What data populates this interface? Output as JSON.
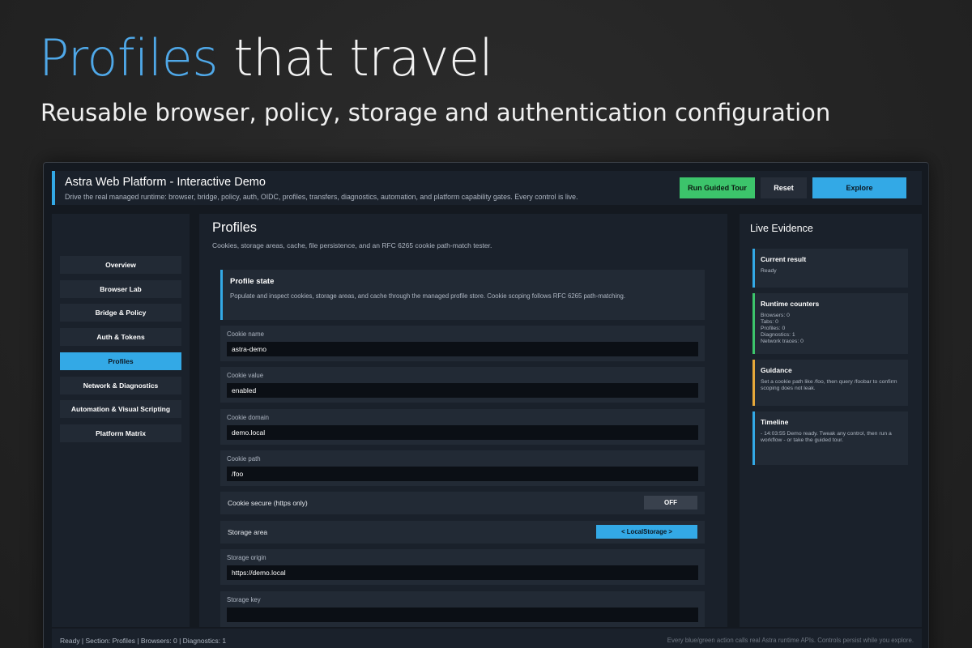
{
  "hero": {
    "title_accent": "Profiles",
    "title_rest": " that travel",
    "subtitle": "Reusable browser, policy, storage and authentication configuration"
  },
  "app": {
    "title": "Astra Web Platform - Interactive Demo",
    "subtitle": "Drive the real managed runtime: browser, bridge, policy, auth, OIDC, profiles, transfers, diagnostics, automation, and platform capability gates. Every control is live.",
    "buttons": {
      "tour": "Run Guided Tour",
      "reset": "Reset",
      "explore": "Explore"
    }
  },
  "sidebar": {
    "items": [
      {
        "label": "Overview"
      },
      {
        "label": "Browser Lab"
      },
      {
        "label": "Bridge & Policy"
      },
      {
        "label": "Auth & Tokens"
      },
      {
        "label": "Profiles"
      },
      {
        "label": "Network & Diagnostics"
      },
      {
        "label": "Automation & Visual Scripting"
      },
      {
        "label": "Platform Matrix"
      }
    ],
    "active_index": 4
  },
  "main": {
    "title": "Profiles",
    "subtitle": "Cookies, storage areas, cache, file persistence, and an RFC 6265 cookie path-match tester.",
    "state_card": {
      "title": "Profile state",
      "description": "Populate and inspect cookies, storage areas, and cache through the managed profile store. Cookie scoping follows RFC 6265 path-matching."
    },
    "fields": {
      "cookie_name": {
        "label": "Cookie name",
        "value": "astra-demo"
      },
      "cookie_value": {
        "label": "Cookie value",
        "value": "enabled"
      },
      "cookie_domain": {
        "label": "Cookie domain",
        "value": "demo.local"
      },
      "cookie_path": {
        "label": "Cookie path",
        "value": "/foo"
      },
      "storage_origin": {
        "label": "Storage origin",
        "value": "https://demo.local"
      },
      "storage_key": {
        "label": "Storage key",
        "value": ""
      }
    },
    "cookie_secure": {
      "label": "Cookie secure (https only)",
      "state": "OFF"
    },
    "storage_area": {
      "label": "Storage area",
      "selected": "< LocalStorage >"
    }
  },
  "evidence": {
    "title": "Live Evidence",
    "cards": [
      {
        "title": "Current result",
        "lines": [
          "Ready"
        ],
        "color": "#33a9e6"
      },
      {
        "title": "Runtime counters",
        "lines": [
          "Browsers: 0",
          "Tabs: 0",
          "Profiles: 0",
          "Diagnostics: 1",
          "Network traces: 0"
        ],
        "color": "#3cc46b"
      },
      {
        "title": "Guidance",
        "lines": [
          "Set a cookie path like /foo, then query /foobar to confirm",
          "scoping does not leak."
        ],
        "color": "#e6a83a"
      },
      {
        "title": "Timeline",
        "lines": [
          "- 14:03:55 Demo ready. Tweak any control, then run a",
          "workflow - or take the guided tour."
        ],
        "color": "#33a9e6"
      }
    ]
  },
  "status": {
    "left": "Ready  |  Section: Profiles  |  Browsers: 0  |  Diagnostics: 1",
    "right": "Every blue/green action calls real Astra runtime APIs. Controls persist while you explore."
  }
}
